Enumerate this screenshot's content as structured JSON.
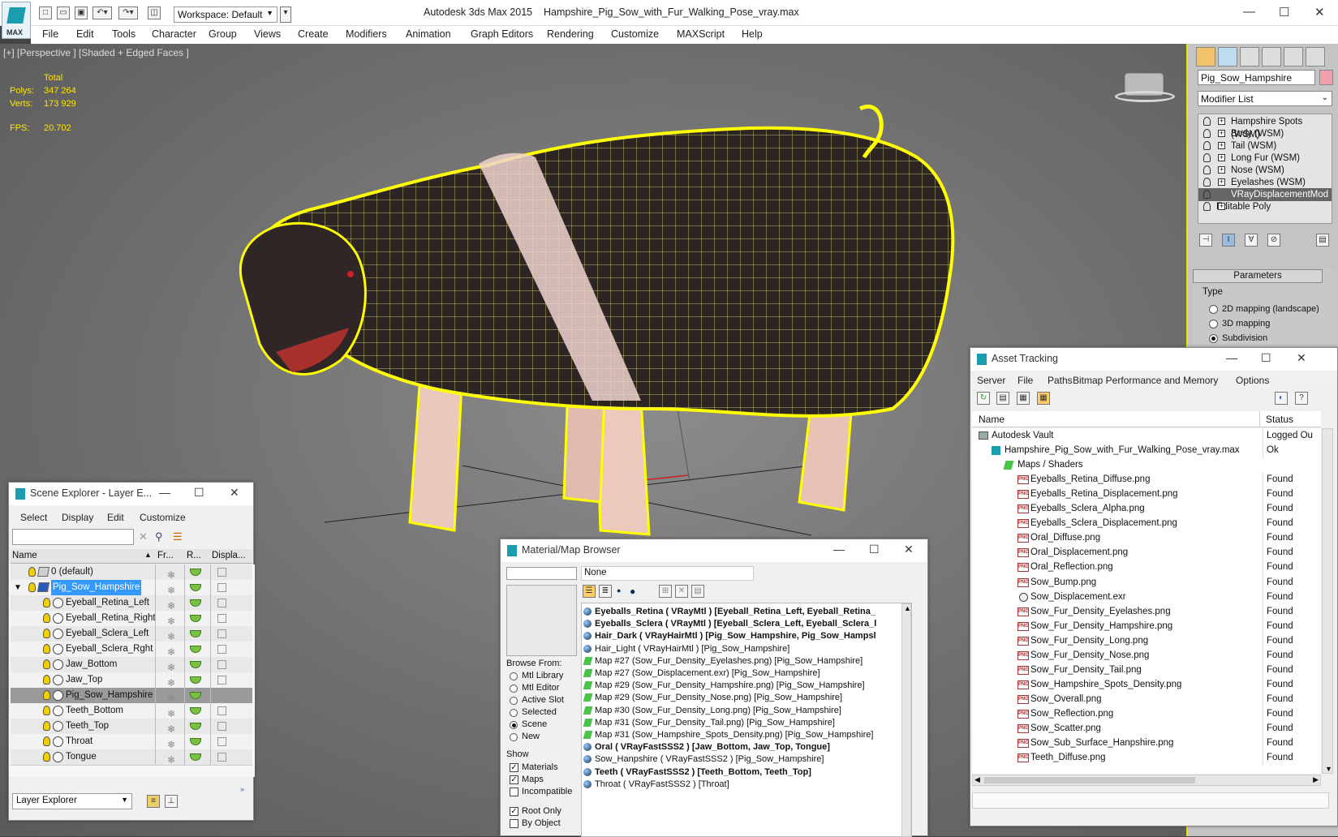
{
  "app": {
    "title": "Autodesk 3ds Max 2015",
    "file": "Hampshire_Pig_Sow_with_Fur_Walking_Pose_vray.max",
    "logo_text": "MAX",
    "workspace": "Workspace: Default"
  },
  "menu": [
    "File",
    "Edit",
    "Tools",
    "Character",
    "Group",
    "Views",
    "Create",
    "Modifiers",
    "Animation",
    "Graph Editors",
    "Rendering",
    "Customize",
    "MAXScript",
    "Help"
  ],
  "viewport": {
    "label": "[+] [Perspective ] [Shaded + Edged Faces ]",
    "total_label": "Total",
    "polys_label": "Polys:",
    "polys": "347 264",
    "verts_label": "Verts:",
    "verts": "173 929",
    "fps_label": "FPS:",
    "fps": "20.702"
  },
  "command_panel": {
    "object_name": "Pig_Sow_Hampshire",
    "modifier_list": "Modifier List",
    "stack": [
      "Hampshire Spots (WSM)",
      "Body (WSM)",
      "Tail (WSM)",
      "Long Fur (WSM)",
      "Nose (WSM)",
      "Eyelashes (WSM)",
      "VRayDisplacementMod",
      "Editable Poly"
    ],
    "selected_index": 6,
    "parameters_title": "Parameters",
    "type_label": "Type",
    "type_options": [
      "2D mapping (landscape)",
      "3D mapping",
      "Subdivision"
    ],
    "type_selected": 2
  },
  "scene_explorer": {
    "title": "Scene Explorer - Layer E...",
    "menu": [
      "Select",
      "Display",
      "Edit",
      "Customize"
    ],
    "columns": [
      "Name",
      "Fr...",
      "R...",
      "Displa..."
    ],
    "rows": [
      {
        "name": "0 (default)",
        "level": 0,
        "type": "layer"
      },
      {
        "name": "Pig_Sow_Hampshire",
        "level": 0,
        "type": "layer",
        "selected": true
      },
      {
        "name": "Eyeball_Retina_Left",
        "level": 1
      },
      {
        "name": "Eyeball_Retina_Right",
        "level": 1
      },
      {
        "name": "Eyeball_Sclera_Left",
        "level": 1
      },
      {
        "name": "Eyeball_Sclera_Rght",
        "level": 1
      },
      {
        "name": "Jaw_Bottom",
        "level": 1
      },
      {
        "name": "Jaw_Top",
        "level": 1
      },
      {
        "name": "Pig_Sow_Hampshire",
        "level": 1,
        "highlight": true
      },
      {
        "name": "Teeth_Bottom",
        "level": 1
      },
      {
        "name": "Teeth_Top",
        "level": 1
      },
      {
        "name": "Throat",
        "level": 1
      },
      {
        "name": "Tongue",
        "level": 1
      }
    ],
    "footer": "Layer Explorer"
  },
  "material_browser": {
    "title": "Material/Map Browser",
    "search_value": "None",
    "browse_from_label": "Browse From:",
    "browse_from": [
      "Mtl Library",
      "Mtl Editor",
      "Active Slot",
      "Selected",
      "Scene",
      "New"
    ],
    "browse_selected": 4,
    "show_label": "Show",
    "show": [
      {
        "label": "Materials",
        "checked": true
      },
      {
        "label": "Maps",
        "checked": true
      },
      {
        "label": "Incompatible",
        "checked": false
      }
    ],
    "root_only": {
      "label": "Root Only",
      "checked": true
    },
    "by_object": {
      "label": "By Object",
      "checked": false
    },
    "items": [
      {
        "text": "Eyeballs_Retina  ( VRayMtl )  [Eyeball_Retina_Left, Eyeball_Retina_",
        "kind": "mtl",
        "bold": true
      },
      {
        "text": "Eyeballs_Sclera  ( VRayMtl )  [Eyeball_Sclera_Left, Eyeball_Sclera_l",
        "kind": "mtl",
        "bold": true
      },
      {
        "text": "Hair_Dark  ( VRayHairMtl )  [Pig_Sow_Hampshire, Pig_Sow_Hampsl",
        "kind": "mtl",
        "bold": true
      },
      {
        "text": "Hair_Light  ( VRayHairMtl )  [Pig_Sow_Hampshire]",
        "kind": "mtl",
        "bold": false
      },
      {
        "text": "Map #27 (Sow_Fur_Density_Eyelashes.png)  [Pig_Sow_Hampshire]",
        "kind": "map",
        "bold": false
      },
      {
        "text": "Map #27 (Sow_Displacement.exr)  [Pig_Sow_Hampshire]",
        "kind": "map",
        "bold": false
      },
      {
        "text": "Map #29 (Sow_Fur_Density_Hampshire.png)  [Pig_Sow_Hampshire]",
        "kind": "map",
        "bold": false
      },
      {
        "text": "Map #29 (Sow_Fur_Density_Nose.png)  [Pig_Sow_Hampshire]",
        "kind": "map",
        "bold": false
      },
      {
        "text": "Map #30 (Sow_Fur_Density_Long.png)  [Pig_Sow_Hampshire]",
        "kind": "map",
        "bold": false
      },
      {
        "text": "Map #31 (Sow_Fur_Density_Tail.png)  [Pig_Sow_Hampshire]",
        "kind": "map",
        "bold": false
      },
      {
        "text": "Map #31 (Sow_Hampshire_Spots_Density.png)  [Pig_Sow_Hampshire]",
        "kind": "map",
        "bold": false
      },
      {
        "text": "Oral  ( VRayFastSSS2 )  [Jaw_Bottom, Jaw_Top, Tongue]",
        "kind": "mtl",
        "bold": true
      },
      {
        "text": "Sow_Hanpshire  ( VRayFastSSS2 )  [Pig_Sow_Hampshire]",
        "kind": "mtl",
        "bold": false
      },
      {
        "text": "Teeth  ( VRayFastSSS2 )  [Teeth_Bottom, Teeth_Top]",
        "kind": "mtl",
        "bold": true
      },
      {
        "text": "Throat  ( VRayFastSSS2 )  [Throat]",
        "kind": "mtl",
        "bold": false
      }
    ]
  },
  "asset_tracking": {
    "title": "Asset Tracking",
    "menu": [
      "Server",
      "File",
      "Paths",
      "Bitmap Performance and Memory",
      "Options"
    ],
    "col_name": "Name",
    "col_status": "Status",
    "rows": [
      {
        "name": "Autodesk Vault",
        "status": "Logged Ou",
        "indent": 1,
        "icon": "vault"
      },
      {
        "name": "Hampshire_Pig_Sow_with_Fur_Walking_Pose_vray.max",
        "status": "Ok",
        "indent": 2,
        "icon": "max"
      },
      {
        "name": "Maps / Shaders",
        "status": "",
        "indent": 3,
        "icon": "folder"
      },
      {
        "name": "Eyeballs_Retina_Diffuse.png",
        "status": "Found",
        "indent": 4,
        "icon": "png"
      },
      {
        "name": "Eyeballs_Retina_Displacement.png",
        "status": "Found",
        "indent": 4,
        "icon": "png"
      },
      {
        "name": "Eyeballs_Sclera_Alpha.png",
        "status": "Found",
        "indent": 4,
        "icon": "png"
      },
      {
        "name": "Eyeballs_Sclera_Displacement.png",
        "status": "Found",
        "indent": 4,
        "icon": "png"
      },
      {
        "name": "Oral_Diffuse.png",
        "status": "Found",
        "indent": 4,
        "icon": "png"
      },
      {
        "name": "Oral_Displacement.png",
        "status": "Found",
        "indent": 4,
        "icon": "png"
      },
      {
        "name": "Oral_Reflection.png",
        "status": "Found",
        "indent": 4,
        "icon": "png"
      },
      {
        "name": "Sow_Bump.png",
        "status": "Found",
        "indent": 4,
        "icon": "png"
      },
      {
        "name": "Sow_Displacement.exr",
        "status": "Found",
        "indent": 4,
        "icon": "exr"
      },
      {
        "name": "Sow_Fur_Density_Eyelashes.png",
        "status": "Found",
        "indent": 4,
        "icon": "png"
      },
      {
        "name": "Sow_Fur_Density_Hampshire.png",
        "status": "Found",
        "indent": 4,
        "icon": "png"
      },
      {
        "name": "Sow_Fur_Density_Long.png",
        "status": "Found",
        "indent": 4,
        "icon": "png"
      },
      {
        "name": "Sow_Fur_Density_Nose.png",
        "status": "Found",
        "indent": 4,
        "icon": "png"
      },
      {
        "name": "Sow_Fur_Density_Tail.png",
        "status": "Found",
        "indent": 4,
        "icon": "png"
      },
      {
        "name": "Sow_Hampshire_Spots_Density.png",
        "status": "Found",
        "indent": 4,
        "icon": "png"
      },
      {
        "name": "Sow_Overall.png",
        "status": "Found",
        "indent": 4,
        "icon": "png"
      },
      {
        "name": "Sow_Reflection.png",
        "status": "Found",
        "indent": 4,
        "icon": "png"
      },
      {
        "name": "Sow_Scatter.png",
        "status": "Found",
        "indent": 4,
        "icon": "png"
      },
      {
        "name": "Sow_Sub_Surface_Hanpshire.png",
        "status": "Found",
        "indent": 4,
        "icon": "png"
      },
      {
        "name": "Teeth_Diffuse.png",
        "status": "Found",
        "indent": 4,
        "icon": "png"
      }
    ]
  },
  "colors": {
    "accent": "#1b9db0",
    "wire": "#ffff00",
    "highlight": "#3399ff",
    "stat": "#ffe400"
  }
}
